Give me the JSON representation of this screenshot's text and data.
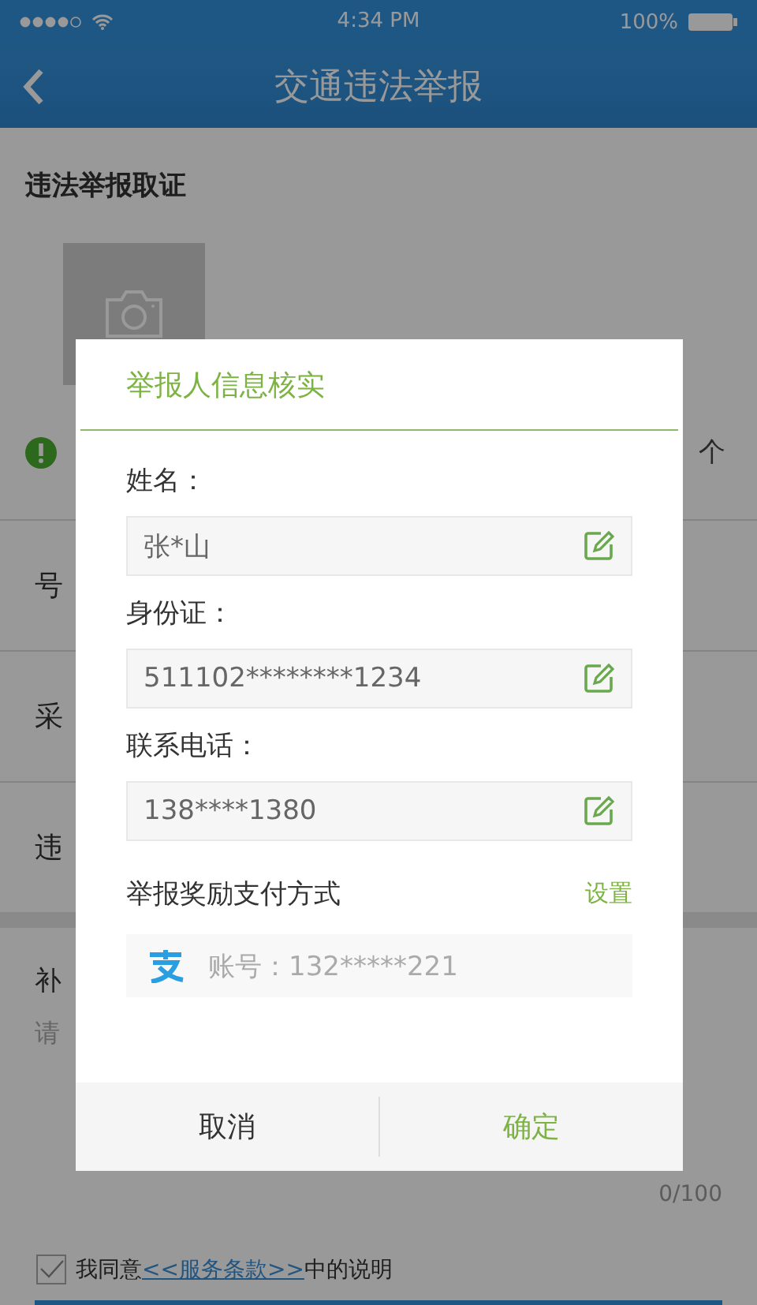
{
  "status_bar": {
    "time": "4:34 PM",
    "battery": "100%"
  },
  "header": {
    "title": "交通违法举报"
  },
  "evidence": {
    "title": "违法举报取证",
    "notice_tail": "个"
  },
  "rows": [
    {
      "label": "号"
    },
    {
      "label": "采"
    },
    {
      "label": "违"
    }
  ],
  "supplement": {
    "title": "补",
    "hint": "请",
    "counter": "0/100"
  },
  "agreement": {
    "checked": true,
    "prefix": "我同意",
    "link": "<<服务条款>>",
    "suffix": "中的说明"
  },
  "dialog": {
    "title": "举报人信息核实",
    "fields": [
      {
        "label": "姓名：",
        "value": "张*山"
      },
      {
        "label": "身份证：",
        "value": "511102********1234"
      },
      {
        "label": "联系电话：",
        "value": "138****1380"
      }
    ],
    "payment": {
      "label": "举报奖励支付方式",
      "action": "设置",
      "account": "账号：132*****221"
    },
    "buttons": [
      {
        "label": "取消",
        "kind": "cancel"
      },
      {
        "label": "确定",
        "kind": "confirm"
      }
    ]
  }
}
